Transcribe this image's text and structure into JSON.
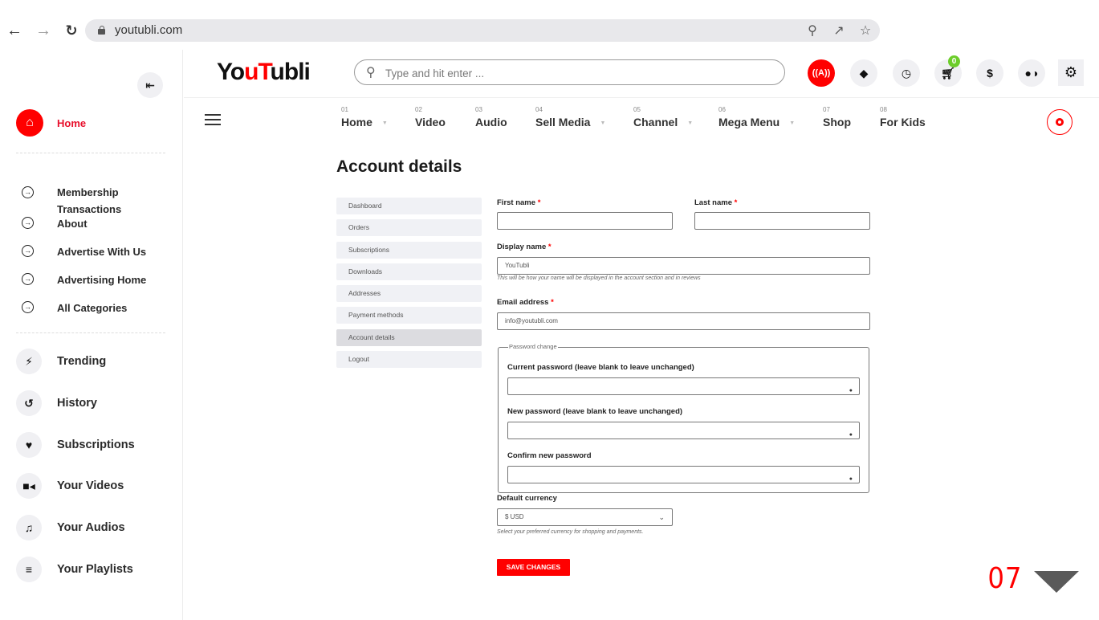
{
  "browser": {
    "url": "youtubli.com",
    "icons": [
      "back-icon",
      "forward-icon",
      "reload-icon",
      "lock-icon",
      "zoom-icon",
      "share-icon",
      "star-icon"
    ]
  },
  "header": {
    "logo": {
      "part1": "Yo",
      "part2": "u",
      "part3": "T",
      "part4": "ubli"
    },
    "search_placeholder": "Type and hit enter ...",
    "cart_count": "0",
    "icons": [
      "live-icon",
      "bell-icon",
      "clock-icon",
      "cart-icon",
      "dollar-icon",
      "user-shield-icon",
      "settings-icon"
    ]
  },
  "sidebar": {
    "home_label": "Home",
    "sub_items": [
      {
        "label": "Membership Transactions"
      },
      {
        "label": "About"
      },
      {
        "label": "Advertise With Us"
      },
      {
        "label": "Advertising Home"
      },
      {
        "label": "All Categories"
      }
    ],
    "main_items": [
      {
        "label": "Trending",
        "icon": "bolt-icon"
      },
      {
        "label": "History",
        "icon": "history-icon"
      },
      {
        "label": "Subscriptions",
        "icon": "heart-icon"
      },
      {
        "label": "Your Videos",
        "icon": "video-icon"
      },
      {
        "label": "Your Audios",
        "icon": "music-icon"
      },
      {
        "label": "Your Playlists",
        "icon": "list-icon"
      }
    ]
  },
  "topnav": [
    {
      "num": "01",
      "label": "Home",
      "has_dropdown": true
    },
    {
      "num": "02",
      "label": "Video",
      "has_dropdown": false
    },
    {
      "num": "03",
      "label": "Audio",
      "has_dropdown": false
    },
    {
      "num": "04",
      "label": "Sell Media",
      "has_dropdown": true
    },
    {
      "num": "05",
      "label": "Channel",
      "has_dropdown": true
    },
    {
      "num": "06",
      "label": "Mega Menu",
      "has_dropdown": true
    },
    {
      "num": "07",
      "label": "Shop",
      "has_dropdown": false
    },
    {
      "num": "08",
      "label": "For Kids",
      "has_dropdown": false
    }
  ],
  "page": {
    "title": "Account details",
    "account_nav": [
      {
        "label": "Dashboard",
        "active": false
      },
      {
        "label": "Orders",
        "active": false
      },
      {
        "label": "Subscriptions",
        "active": false
      },
      {
        "label": "Downloads",
        "active": false
      },
      {
        "label": "Addresses",
        "active": false
      },
      {
        "label": "Payment methods",
        "active": false
      },
      {
        "label": "Account details",
        "active": true
      },
      {
        "label": "Logout",
        "active": false
      }
    ],
    "form": {
      "first_name_label": "First name",
      "first_name_value": "",
      "last_name_label": "Last name",
      "last_name_value": "",
      "display_name_label": "Display name",
      "display_name_value": "YouTubli",
      "display_name_help": "This will be how your name will be displayed in the account section and in reviews",
      "email_label": "Email address",
      "email_value": "info@youtubli.com",
      "required_mark": "*",
      "password_legend": "Password change",
      "current_password_label": "Current password (leave blank to leave unchanged)",
      "new_password_label": "New password (leave blank to leave unchanged)",
      "confirm_password_label": "Confirm new password",
      "currency_label": "Default currency",
      "currency_value": "$ USD",
      "currency_help": "Select your preferred currency for shopping and payments.",
      "save_label": "SAVE CHANGES"
    },
    "page_number": "07"
  }
}
